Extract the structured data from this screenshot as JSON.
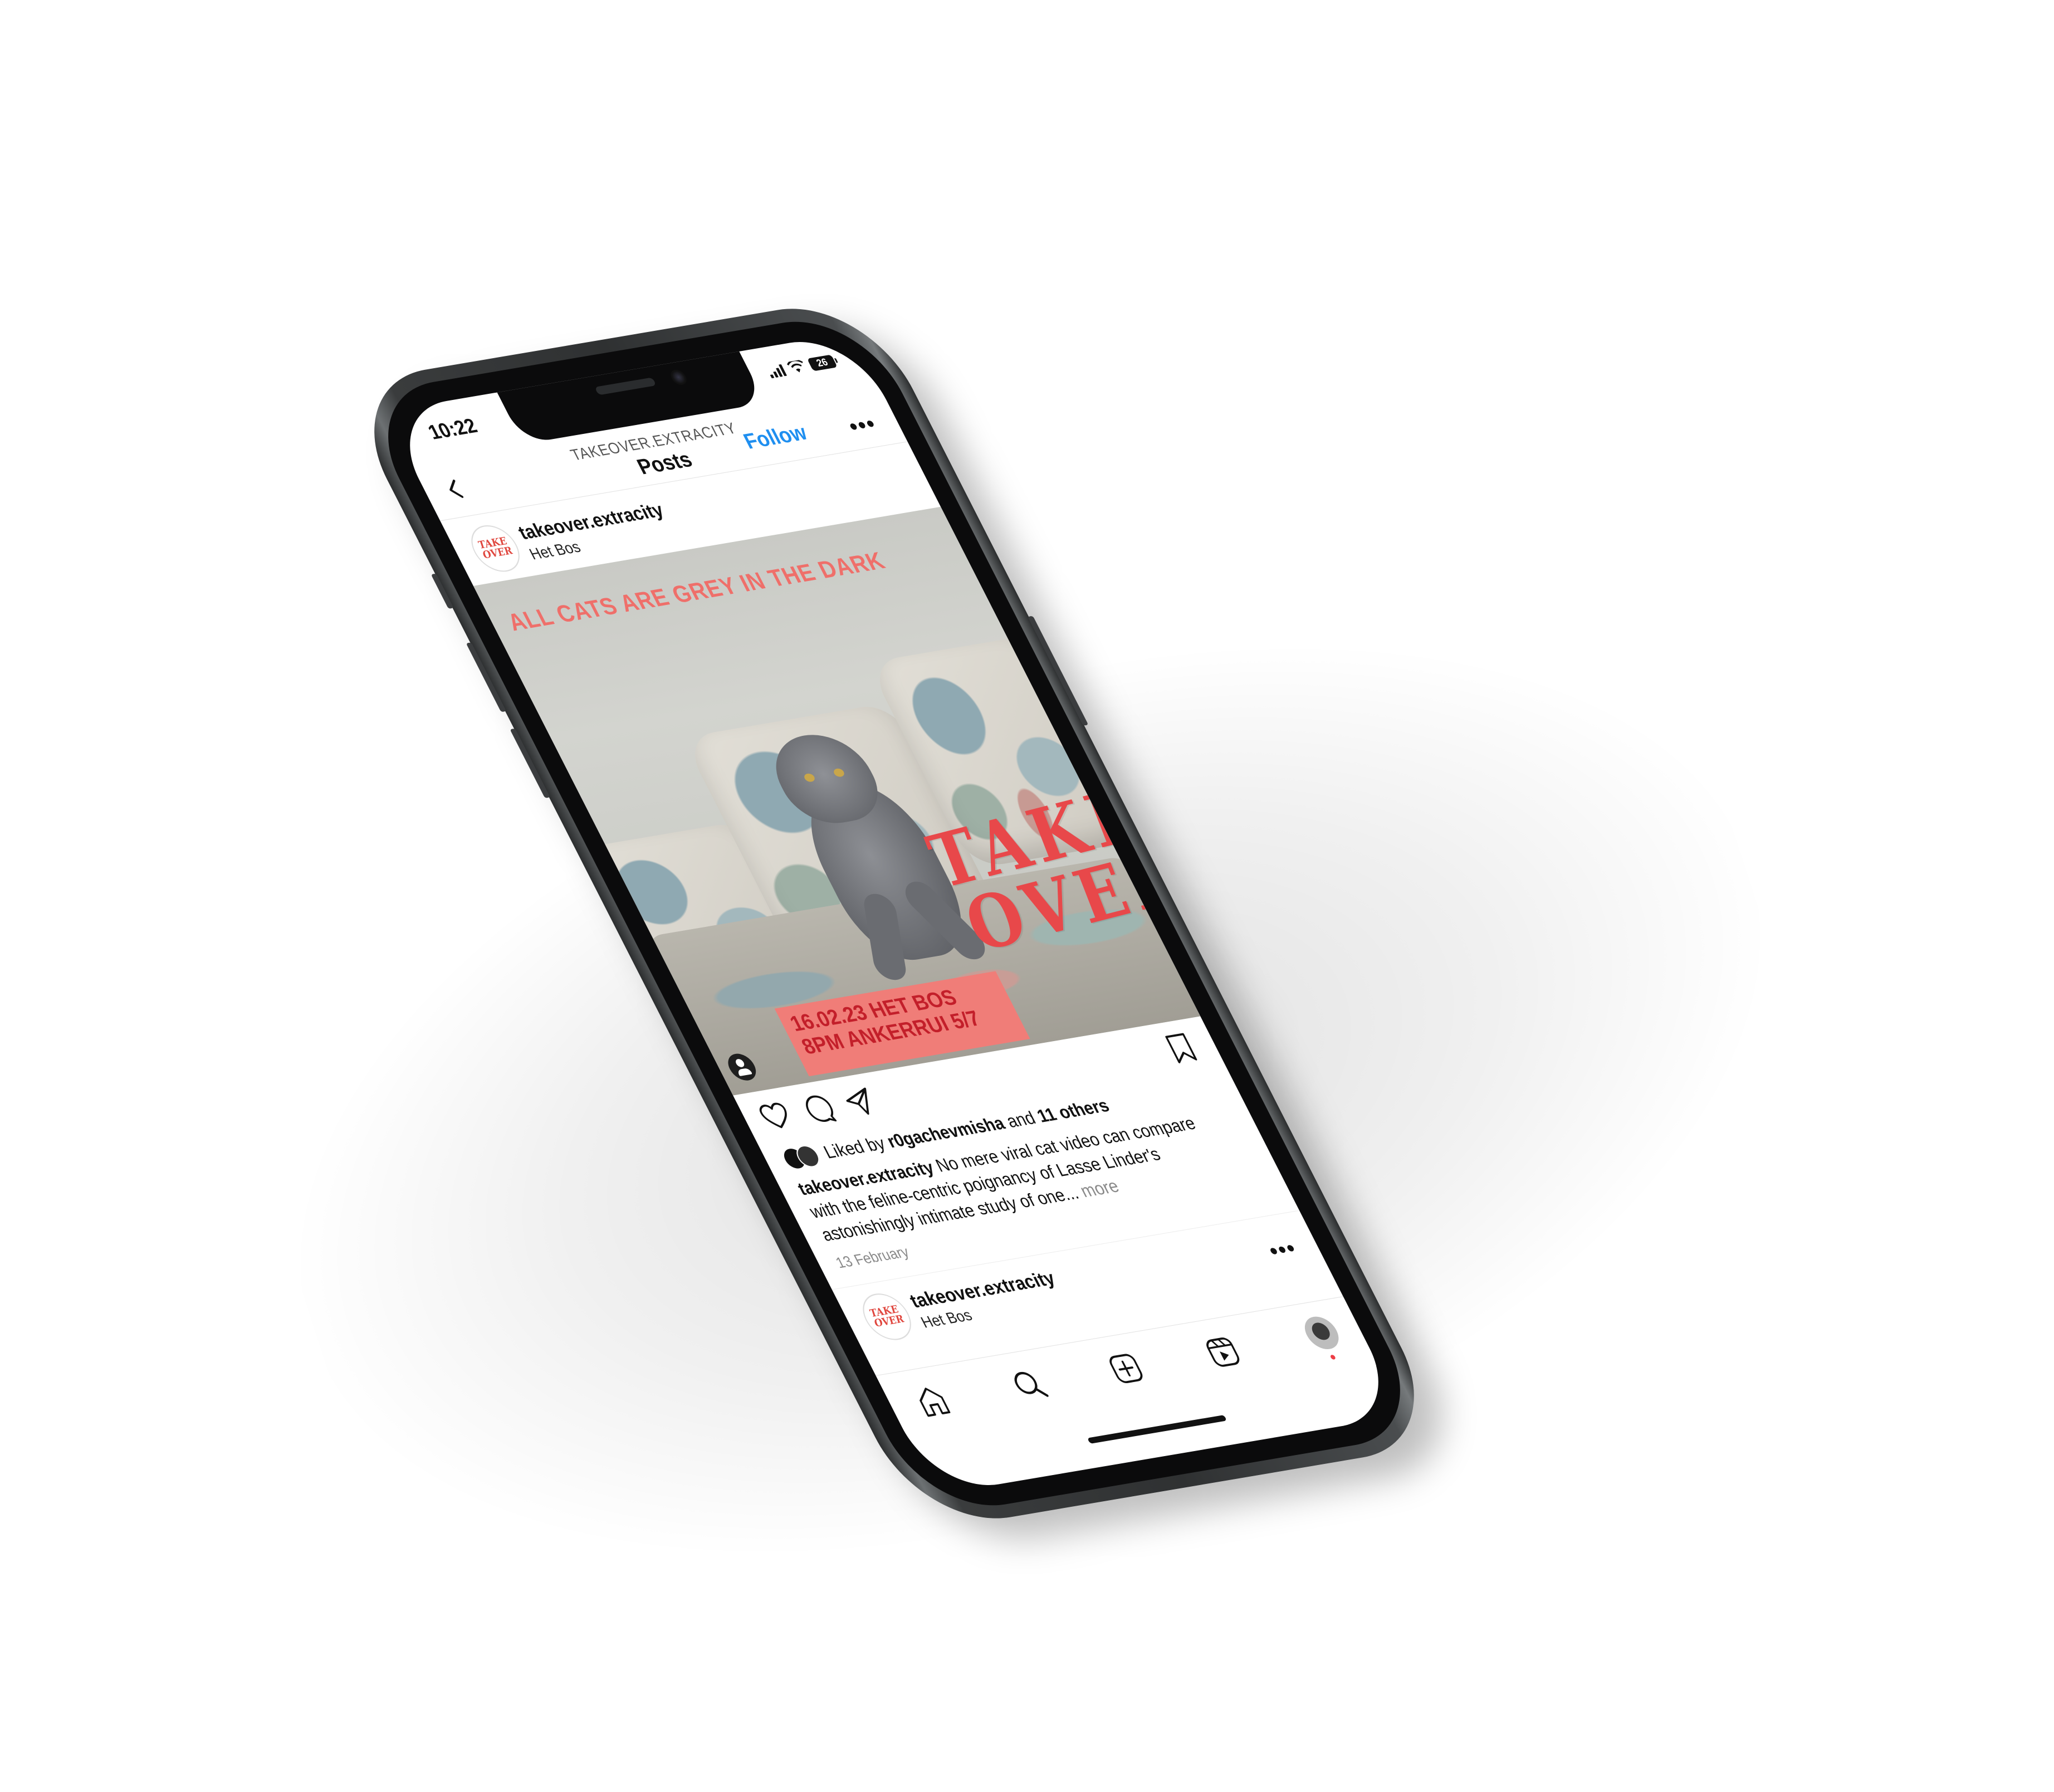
{
  "status": {
    "time": "10:22",
    "battery": "26"
  },
  "nav": {
    "username": "TAKEOVER.EXTRACITY",
    "title": "Posts",
    "follow": "Follow"
  },
  "post": {
    "username": "takeover.extracity",
    "location": "Het Bos",
    "avatar_text": [
      "TAKE",
      "OVER"
    ],
    "image": {
      "headline": "ALL CATS ARE GREY IN THE DARK",
      "takeover_line1": "TAKE",
      "takeover_line2": "OVER",
      "event_line1": "16.02.23  HET BOS",
      "event_line2": "8PM          ANKERRUI 5/7"
    },
    "likes_prefix": "Liked by ",
    "likes_user": "r0gachevmisha",
    "likes_mid": " and ",
    "likes_others": "11 others",
    "caption_user": "takeover.extracity",
    "caption_text": " No mere viral cat video can compare with the feline-centric poignancy of Lasse Linder's astonishingly intimate study of one...",
    "caption_more": " more",
    "date": "13 February"
  },
  "next_post": {
    "username": "takeover.extracity",
    "location": "Het Bos",
    "avatar_text": [
      "TAKE",
      "OVER"
    ]
  },
  "icons": {
    "back": "chevron-left-icon",
    "more": "more-horizontal-icon",
    "like": "heart-icon",
    "comment": "comment-icon",
    "share": "send-icon",
    "save": "bookmark-icon",
    "home": "home-icon",
    "search": "search-icon",
    "create": "plus-square-icon",
    "reels": "reels-icon",
    "profile": "profile-avatar-icon"
  },
  "colors": {
    "accent": "#1f8ff0",
    "brand_red": "#e8484a",
    "notification": "#ed3e46"
  }
}
